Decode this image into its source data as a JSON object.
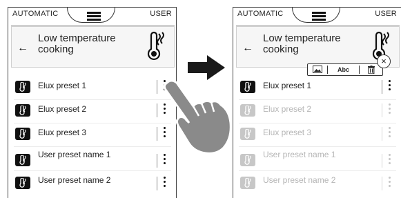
{
  "left_screen": {
    "mode_left": "AUTOMATIC",
    "mode_right": "USER",
    "title": "Low temperature cooking",
    "items": [
      {
        "label": "Elux preset 1"
      },
      {
        "label": "Elux preset 2"
      },
      {
        "label": "Elux preset 3"
      },
      {
        "label": "User preset name 1"
      },
      {
        "label": "User preset name 2"
      }
    ]
  },
  "right_screen": {
    "mode_left": "AUTOMATIC",
    "mode_right": "USER",
    "title": "Low temperature cooking",
    "toolbar": {
      "rename_label": "Abc"
    },
    "close_symbol": "×",
    "items": [
      {
        "label": "Elux preset 1"
      },
      {
        "label": "Elux preset 2"
      },
      {
        "label": "Elux preset 3"
      },
      {
        "label": "User preset name 1"
      },
      {
        "label": "User preset name 2"
      }
    ]
  },
  "icons": {
    "menu": "menu-icon",
    "back": "back-arrow-icon",
    "category": "thermometer-icon",
    "item": "thermometer-icon",
    "more": "more-vertical-icon",
    "toolbar": [
      "image-icon",
      "rename-icon",
      "trash-icon"
    ],
    "close": "close-icon"
  },
  "colors": {
    "active_icon_bg": "#111111",
    "dim_text": "#b5b5b5",
    "hand": "#8a8a8a",
    "arrow": "#1a1a1a"
  },
  "arrow_symbol": "→",
  "back_symbol": "←"
}
